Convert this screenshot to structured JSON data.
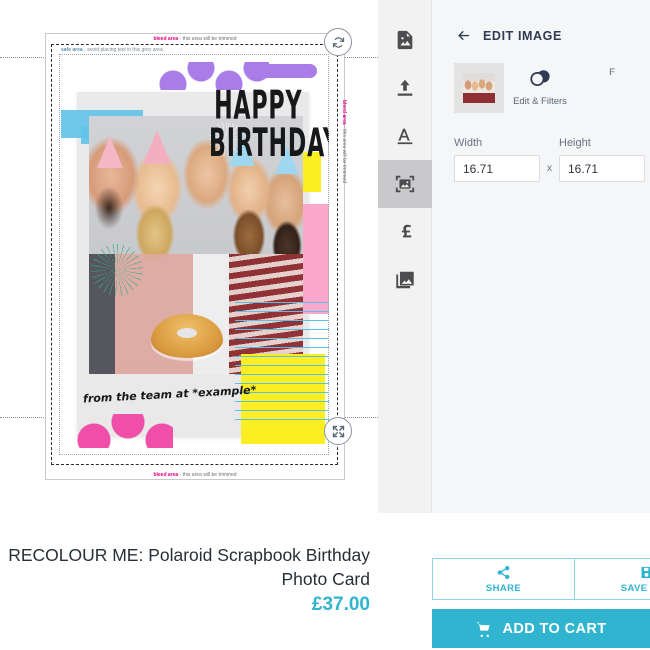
{
  "canvas": {
    "bleed_label_top": "bleed area - this area will be trimmed",
    "bleed_label_bottom": "bleed area - this area will be trimmed",
    "bleed_label_right": "bleed area - this area will be trimmed",
    "safe_label": "safe area - avoid placing text in this grey area",
    "card": {
      "headline_line1": "HAPPY",
      "headline_line2": "BIRTHDAY",
      "signature": "from the team at *example*"
    },
    "handles": {
      "rotate": "rotate-handle",
      "resize": "resize-handle"
    }
  },
  "tool_rail": {
    "items": [
      {
        "name": "design-templates",
        "icon": "document-image-icon",
        "active": false
      },
      {
        "name": "upload",
        "icon": "upload-icon",
        "active": false
      },
      {
        "name": "text",
        "icon": "text-a-icon",
        "active": false
      },
      {
        "name": "image",
        "icon": "image-frame-icon",
        "active": true
      },
      {
        "name": "price",
        "icon": "pound-sterling-icon",
        "active": false
      },
      {
        "name": "gallery",
        "icon": "photo-stack-icon",
        "active": false
      }
    ]
  },
  "edit_panel": {
    "back_icon": "back-arrow-icon",
    "title": "EDIT IMAGE",
    "thumbnail_alt": "selected-photo-thumbnail",
    "actions": [
      {
        "label": "Edit & Filters",
        "icon": "filters-circles-icon"
      },
      {
        "label": "F",
        "icon": "partial-icon"
      }
    ],
    "width_label": "Width",
    "width_value": "16.71",
    "multiply_symbol": "x",
    "height_label": "Height",
    "height_value": "16.71"
  },
  "bottom": {
    "product_title": "RECOLOUR ME: Polaroid Scrapbook Birthday Photo Card",
    "price": "£37.00",
    "share_label": "SHARE",
    "share_icon": "share-nodes-icon",
    "save_label": "SAVE DES",
    "save_icon": "floppy-save-icon",
    "cart_label": "ADD TO CART",
    "cart_icon": "shopping-cart-icon"
  },
  "colors": {
    "accent_teal": "#31b4cf",
    "panel_bg": "#f5f6f8",
    "rail_bg": "#f2f2f3",
    "active_tool": "#c9c9cb",
    "bleed_pink": "#e5007e",
    "text_dark": "#283037"
  }
}
